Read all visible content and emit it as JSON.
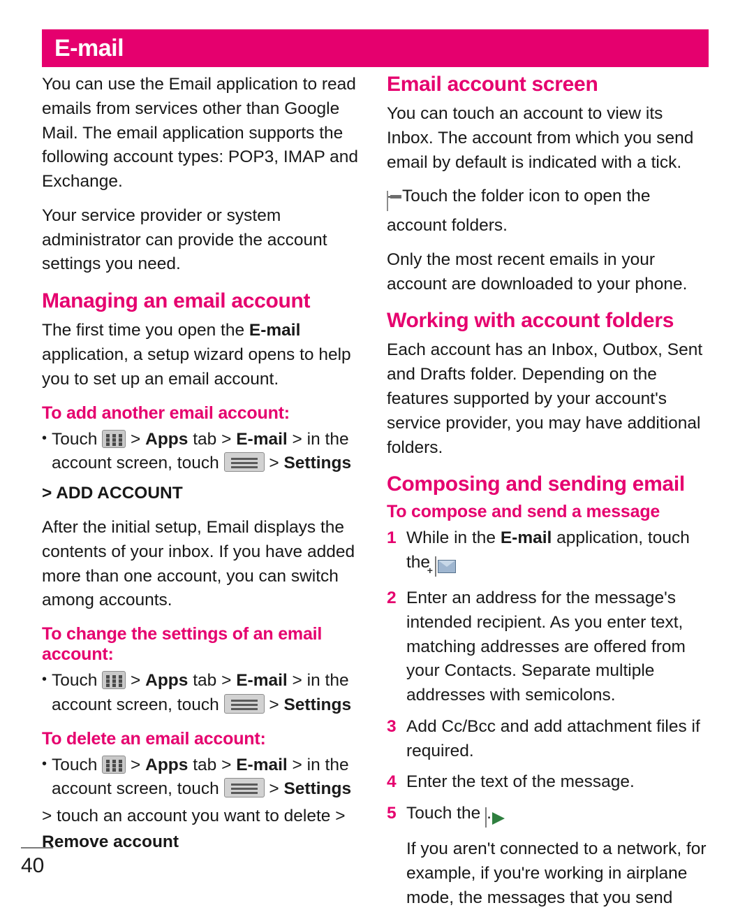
{
  "header": {
    "title": "E-mail",
    "accent_color": "#e5006e"
  },
  "page_number": "40",
  "left_column": {
    "intro_paragraph_1": "You can use the Email application to read emails from services other than Google Mail. The email application supports the following account types: POP3, IMAP and Exchange.",
    "intro_paragraph_2": "Your service provider or system administrator can provide the account settings you need.",
    "section_managing": {
      "heading": "Managing an email account",
      "paragraph": {
        "part1": "The first time you open the ",
        "bold1": "E-mail",
        "part2": " application, a setup wizard opens to help you to set up an email account."
      },
      "sub_add": {
        "heading": "To add another email account:",
        "touch_label": "Touch",
        "sep1": ">",
        "apps_label": "Apps",
        "tab_label": "tab",
        "sep2": ">",
        "email_label": "E-mail",
        "sep3": ">",
        "in_the": "in the account screen, touch",
        "sep4": ">",
        "settings_label": "Settings",
        "add_account_line": "> ADD ACCOUNT"
      },
      "after_setup_paragraph": "After the initial setup, Email displays the contents of your inbox. If you have added more than one account, you can switch among accounts.",
      "sub_change": {
        "heading": "To change the settings of an email account:",
        "touch_label": "Touch",
        "apps_label": "Apps",
        "tab_label": "tab",
        "email_label": "E-mail",
        "in_the": "in the account screen, touch",
        "settings_label": "Settings"
      },
      "sub_delete": {
        "heading": "To delete an email account:",
        "touch_label": "Touch",
        "apps_label": "Apps",
        "tab_label": "tab",
        "email_label": "E-mail",
        "in_the": "in the account screen, touch",
        "settings_label": "Settings",
        "delete_line": "> touch an account you want to delete >",
        "remove_account_label": "Remove account"
      }
    }
  },
  "right_column": {
    "section_account_screen": {
      "heading": "Email account screen",
      "paragraph_1": "You can touch an account to view its Inbox. The account from which you send email by default is indicated with a tick.",
      "folder_line": "– Touch the folder icon to open the account folders.",
      "paragraph_2": "Only the most recent emails in your account are downloaded to your phone."
    },
    "section_folders": {
      "heading": "Working with account folders",
      "paragraph": "Each account has an Inbox, Outbox, Sent and Drafts folder. Depending on the features supported by your account's service provider, you may have additional folders."
    },
    "section_composing": {
      "heading": "Composing and sending email",
      "sub_heading": "To compose and send a message",
      "steps": [
        {
          "num": "1",
          "text_part1": "While in the ",
          "bold": "E-mail",
          "text_part2": " application, touch the ",
          "text_part3": "."
        },
        {
          "num": "2",
          "text": "Enter an address for the message's intended recipient. As you enter text, matching addresses are offered from your Contacts. Separate multiple addresses with semicolons."
        },
        {
          "num": "3",
          "text": "Add Cc/Bcc and add attachment files if required."
        },
        {
          "num": "4",
          "text": "Enter the text of the message."
        },
        {
          "num": "5",
          "text_part1": "Touch the ",
          "text_part2": "."
        }
      ],
      "closing_paragraph": "If you aren't connected to a network, for example, if you're working in airplane mode, the messages that you send"
    }
  }
}
